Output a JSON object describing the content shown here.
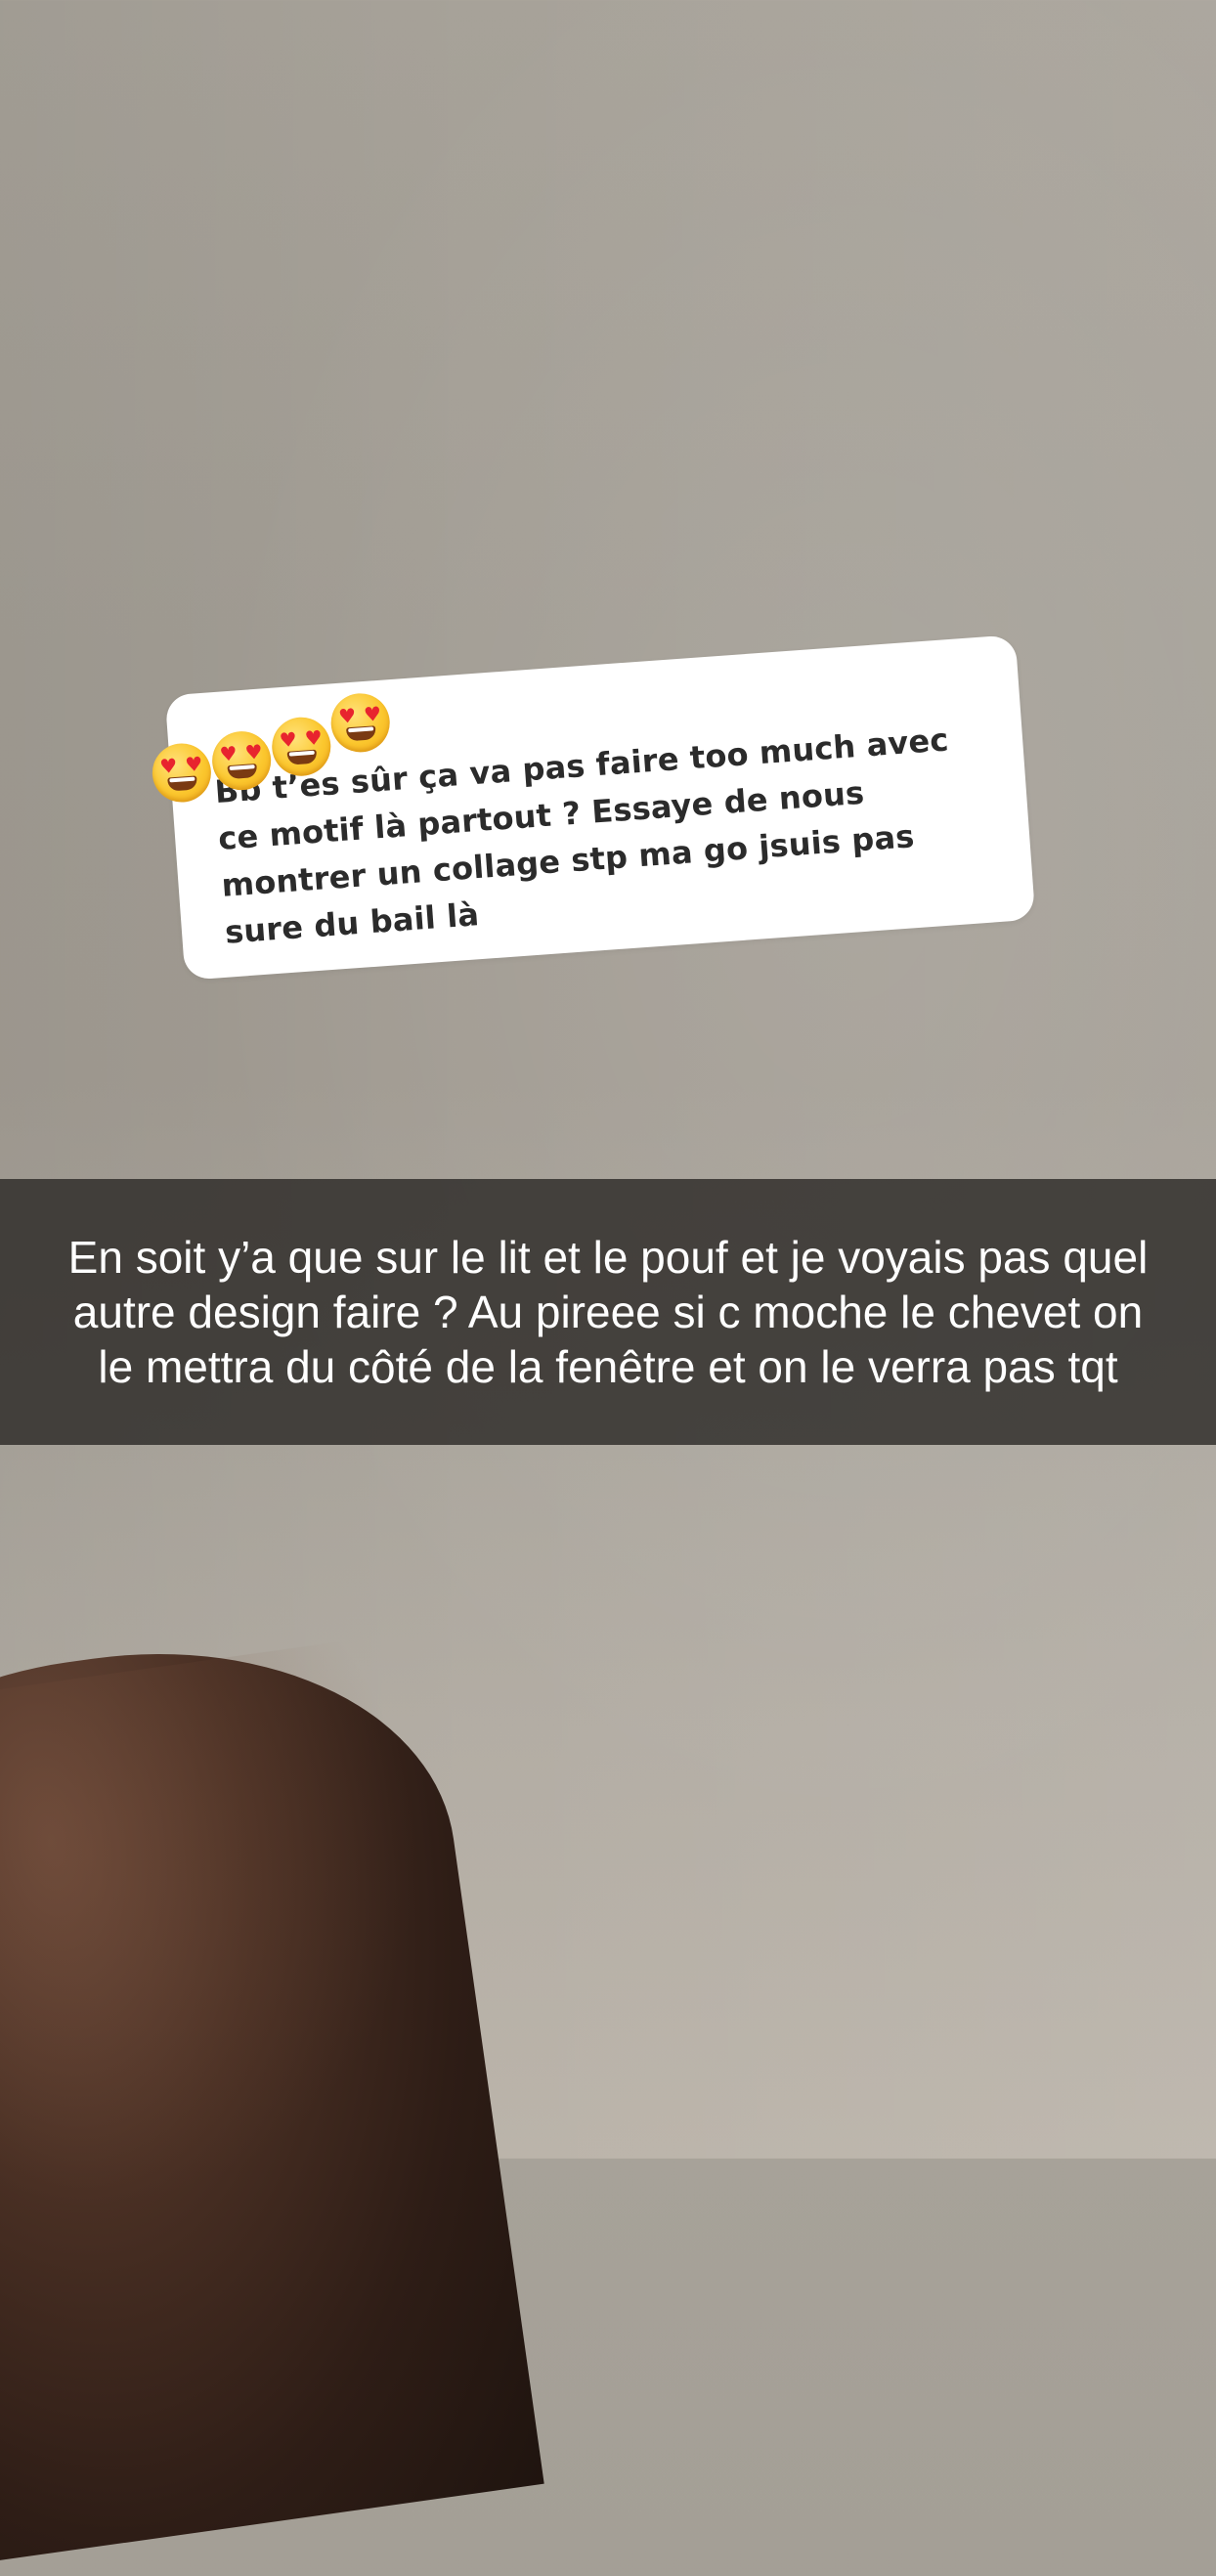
{
  "story": {
    "reply_card": {
      "sender": "",
      "message": "Bb t’es sûr ça va pas faire too much avec ce motif là partout ? Essaye de nous montrer un collage stp ma go jsuis pas sure du bail là",
      "reaction_emojis": [
        "heart-eyes-emoji",
        "heart-eyes-emoji",
        "heart-eyes-emoji",
        "heart-eyes-emoji"
      ]
    },
    "caption": "En soit y’a que sur le lit et le pouf et je voyais pas quel autre design faire ? Au pireee si c moche le chevet on le mettra du côté de la fenêtre et on le verra pas tqt",
    "colors": {
      "background": "#a29d94",
      "caption_bar": "#262421",
      "card": "#ffffff",
      "card_text": "#2b2b2b",
      "heart": "#e8242e"
    }
  }
}
